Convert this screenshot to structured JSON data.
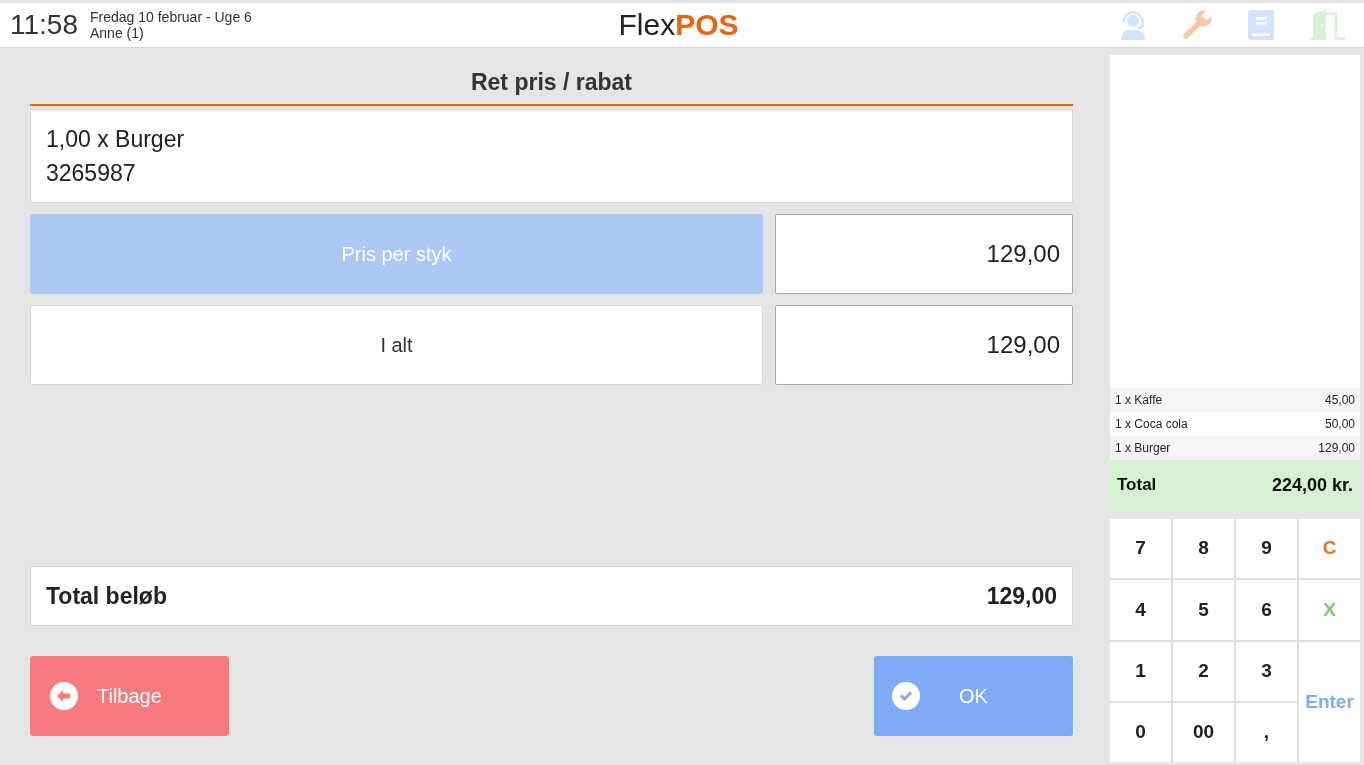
{
  "header": {
    "time": "11:58",
    "date": "Fredag 10 februar - Uge 6",
    "user": "Anne (1)",
    "logo": {
      "light": "Flex",
      "bold": "POS"
    }
  },
  "dialog": {
    "title": "Ret pris / rabat",
    "product": {
      "line": "1,00 x Burger",
      "code": "3265987"
    },
    "fields": [
      {
        "label": "Pris per styk",
        "value": "129,00",
        "selected": true
      },
      {
        "label": "I alt",
        "value": "129,00",
        "selected": false
      }
    ],
    "total": {
      "label": "Total beløb",
      "value": "129,00"
    },
    "buttons": [
      {
        "kind": "back",
        "label": "Tilbage"
      },
      {
        "kind": "ok",
        "label": "OK"
      }
    ]
  },
  "receipt": {
    "lines": [
      {
        "item": "1 x Kaffe",
        "amount": "45,00"
      },
      {
        "item": "1 x Coca cola",
        "amount": "50,00"
      },
      {
        "item": "1 x Burger",
        "amount": "129,00"
      }
    ],
    "total": {
      "label": "Total",
      "value": "224,00 kr."
    }
  },
  "keypad": {
    "keys": [
      {
        "label": "7",
        "kind": "digit"
      },
      {
        "label": "8",
        "kind": "digit"
      },
      {
        "label": "9",
        "kind": "digit"
      },
      {
        "label": "C",
        "kind": "clear"
      },
      {
        "label": "4",
        "kind": "digit"
      },
      {
        "label": "5",
        "kind": "digit"
      },
      {
        "label": "6",
        "kind": "digit"
      },
      {
        "label": "X",
        "kind": "cancel"
      },
      {
        "label": "1",
        "kind": "digit"
      },
      {
        "label": "2",
        "kind": "digit"
      },
      {
        "label": "3",
        "kind": "digit"
      },
      {
        "label": "Enter",
        "kind": "enter"
      },
      {
        "label": "0",
        "kind": "digit"
      },
      {
        "label": "00",
        "kind": "digit"
      },
      {
        "label": ",",
        "kind": "digit"
      }
    ]
  }
}
